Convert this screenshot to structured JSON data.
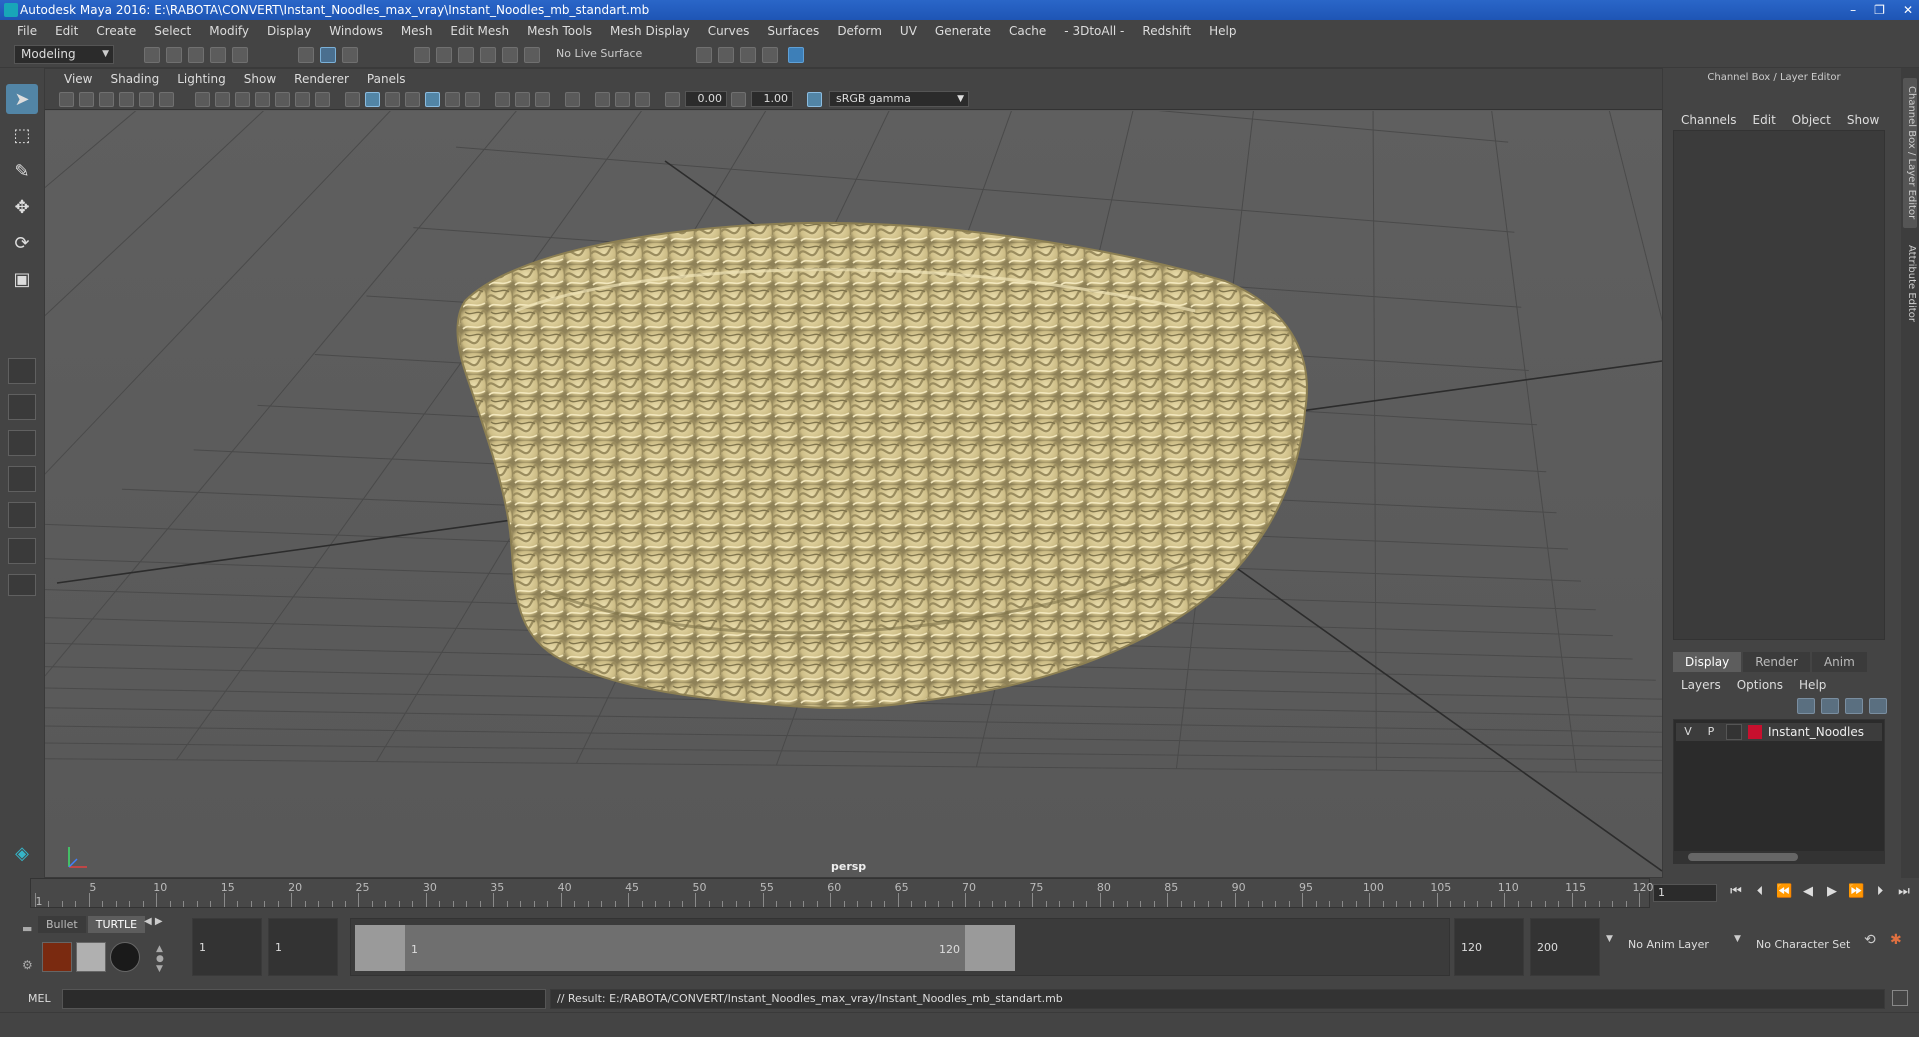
{
  "window": {
    "title": "Autodesk Maya 2016: E:\\RABOTA\\CONVERT\\Instant_Noodles_max_vray\\Instant_Noodles_mb_standart.mb",
    "minimize": "–",
    "restore": "❐",
    "close": "✕"
  },
  "menubar": [
    "File",
    "Edit",
    "Create",
    "Select",
    "Modify",
    "Display",
    "Windows",
    "Mesh",
    "Edit Mesh",
    "Mesh Tools",
    "Mesh Display",
    "Curves",
    "Surfaces",
    "Deform",
    "UV",
    "Generate",
    "Cache",
    "- 3DtoAll -",
    "Redshift",
    "Help"
  ],
  "statusline": {
    "mode": "Modeling",
    "live_surface": "No Live Surface"
  },
  "viewport": {
    "menus": [
      "View",
      "Shading",
      "Lighting",
      "Show",
      "Renderer",
      "Panels"
    ],
    "exposure": "0.00",
    "gamma": "1.00",
    "color_space": "sRGB gamma",
    "camera": "persp"
  },
  "channel_box": {
    "title": "Channel Box / Layer Editor",
    "menus": [
      "Channels",
      "Edit",
      "Object",
      "Show"
    ]
  },
  "side_tabs": [
    "Channel Box / Layer Editor",
    "Attribute Editor"
  ],
  "layer_editor": {
    "tabs": [
      "Display",
      "Render",
      "Anim"
    ],
    "menus": [
      "Layers",
      "Options",
      "Help"
    ],
    "layer": {
      "v": "V",
      "p": "P",
      "name": "Instant_Noodles",
      "color": "#c8102e"
    }
  },
  "timeslider": {
    "start_tick": "1",
    "ticks": [
      "5",
      "10",
      "15",
      "20",
      "25",
      "30",
      "35",
      "40",
      "45",
      "50",
      "55",
      "60",
      "65",
      "70",
      "75",
      "80",
      "85",
      "90",
      "95",
      "100",
      "105",
      "110",
      "115",
      "120"
    ],
    "current_frame": "1"
  },
  "range": {
    "shelf_tabs": [
      "Bullet",
      "TURTLE"
    ],
    "start_time": "1",
    "playback_start": "1",
    "range_start_label": "1",
    "range_end_label": "120",
    "playback_end": "120",
    "end_time": "200",
    "anim_layer": "No Anim Layer",
    "character_set": "No Character Set"
  },
  "cmdline": {
    "language": "MEL",
    "result": "// Result: E:/RABOTA/CONVERT/Instant_Noodles_max_vray/Instant_Noodles_mb_standart.mb"
  }
}
